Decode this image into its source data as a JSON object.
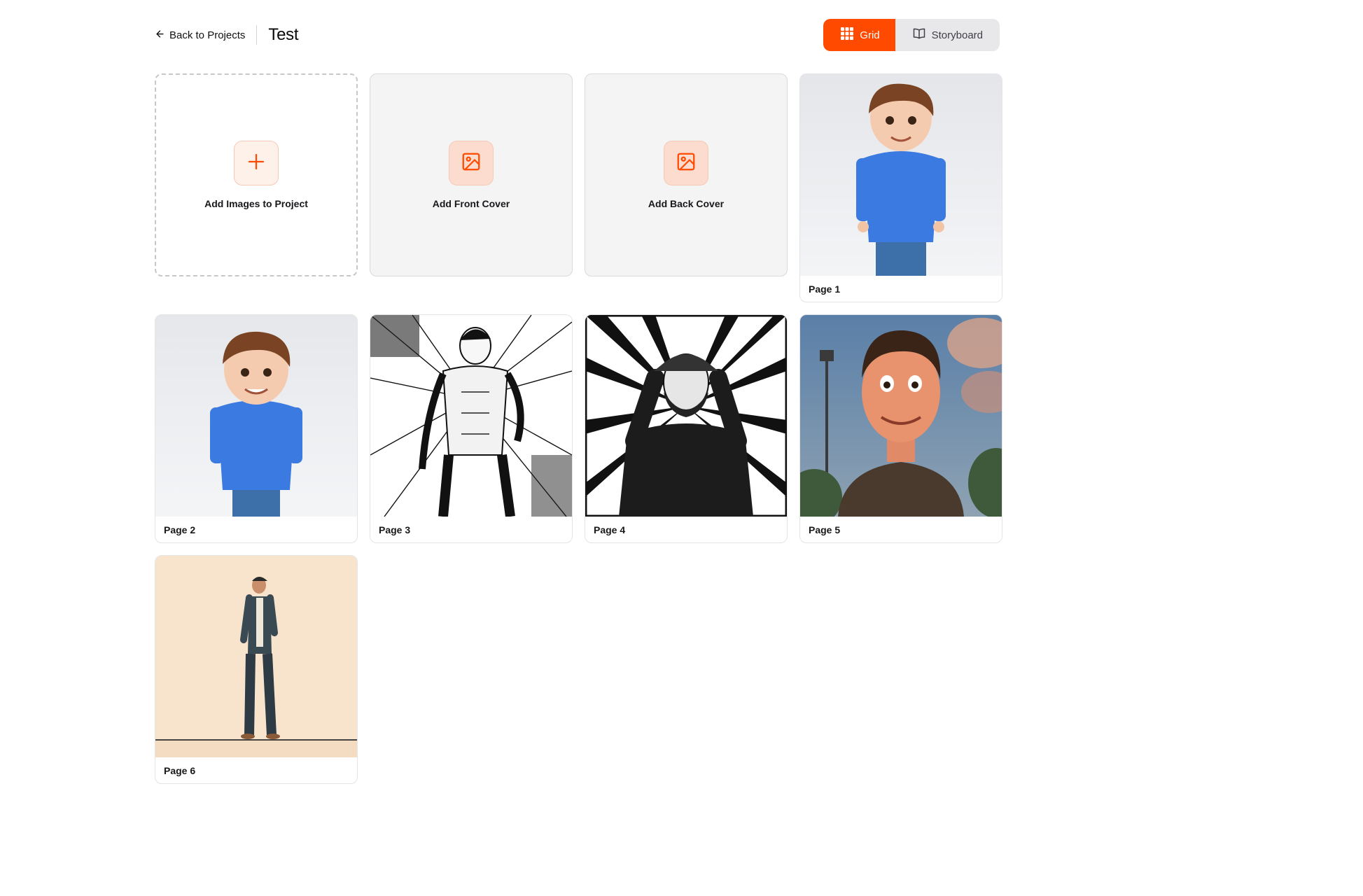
{
  "header": {
    "back_label": "Back to Projects",
    "title": "Test"
  },
  "view_toggle": {
    "grid_label": "Grid",
    "storyboard_label": "Storyboard",
    "active": "Grid",
    "accent_color": "#ff4a00"
  },
  "actions": {
    "add_images_label": "Add Images to Project",
    "add_front_cover_label": "Add Front Cover",
    "add_back_cover_label": "Add Back Cover"
  },
  "pages": [
    {
      "label": "Page 1",
      "image": "cartoon-boy-blue-shirt"
    },
    {
      "label": "Page 2",
      "image": "cartoon-boy-blue-shirt"
    },
    {
      "label": "Page 3",
      "image": "comic-sketch-muscular-man"
    },
    {
      "label": "Page 4",
      "image": "comic-sketch-bearded-man-cap"
    },
    {
      "label": "Page 5",
      "image": "cartoon-smiling-man-sunset"
    },
    {
      "label": "Page 6",
      "image": "illustration-standing-man-beige"
    }
  ]
}
